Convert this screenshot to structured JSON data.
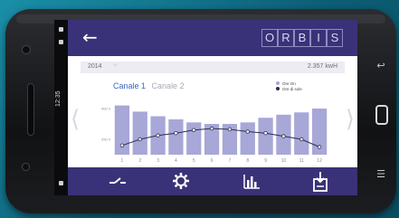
{
  "status": {
    "time": "12:35"
  },
  "header": {
    "back_icon": "arrow-left-icon",
    "brand_letters": [
      "O",
      "R",
      "B",
      "I",
      "S"
    ]
  },
  "summary": {
    "year": "2014",
    "total": "2.357 kwH"
  },
  "tabs": [
    {
      "label": "Canale 1",
      "active": true
    },
    {
      "label": "Canale 2",
      "active": false
    }
  ],
  "legend": {
    "bars": "Ore On",
    "line": "Ore di sole"
  },
  "chart_data": {
    "type": "bar",
    "categories": [
      "1",
      "2",
      "3",
      "4",
      "5",
      "6",
      "7",
      "8",
      "9",
      "10",
      "11",
      "12"
    ],
    "y_ticks": [
      "400 h",
      "200 h"
    ],
    "series": [
      {
        "name": "Ore On",
        "kind": "bar",
        "values": [
          420,
          380,
          350,
          330,
          310,
          300,
          300,
          310,
          340,
          360,
          375,
          400
        ]
      },
      {
        "name": "Ore di sole",
        "kind": "line",
        "values": [
          160,
          200,
          225,
          240,
          260,
          270,
          265,
          250,
          240,
          220,
          200,
          150
        ]
      }
    ],
    "ylim": [
      100,
      500
    ],
    "colors": {
      "bar": "#a7a7d8",
      "line": "#2f2f52",
      "accent": "#3a3278"
    }
  },
  "bottom_nav": [
    {
      "icon": "switch-icon"
    },
    {
      "icon": "gear-icon"
    },
    {
      "icon": "bar-chart-icon"
    },
    {
      "icon": "download-icon"
    }
  ]
}
